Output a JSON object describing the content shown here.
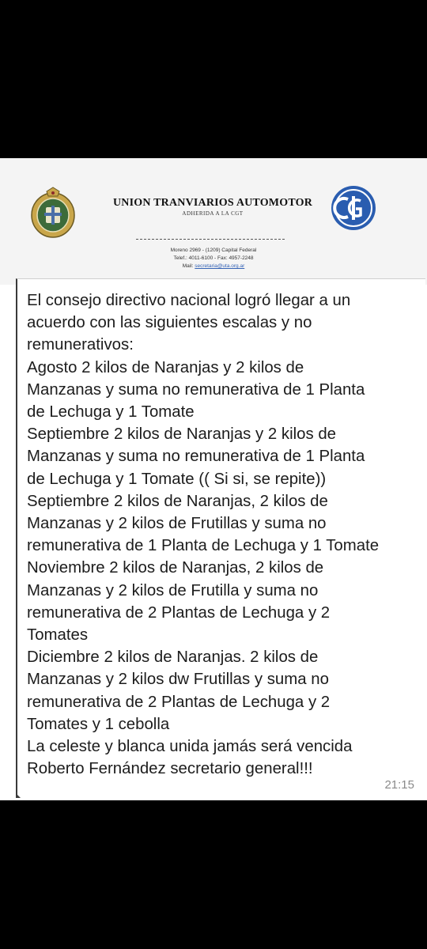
{
  "colors": {
    "background": "#000000",
    "bubble": "#ffffff",
    "letterhead": "#f4f4f4",
    "cgt_blue": "#2a5db0",
    "crest_green": "#3d6b3a",
    "crest_gold": "#c9a64a",
    "timestamp": "#8a8a8a"
  },
  "letterhead": {
    "org_name": "UNION TRANVIARIOS AUTOMOTOR",
    "affiliation": "ADHERIDA A LA CGT",
    "address": "Moreno 2969 - (1209) Capital Federal",
    "phone": "Telef.: 4011-6100 - Fax: 4957-2248",
    "mail_label": "Mail:",
    "mail": "secretaria@uta.org.ar",
    "crest_icon": "union-crest-logo",
    "cgt_icon": "cgt-logo"
  },
  "message": {
    "lines": [
      "El consejo directivo nacional logró llegar  a un",
      "acuerdo con las siguientes escalas y no",
      "remunerativos:",
      " Agosto 2 kilos de Naranjas y 2 kilos de",
      "Manzanas y suma no remunerativa de 1 Planta",
      "de Lechuga y 1 Tomate",
      " Septiembre 2 kilos de Naranjas y 2 kilos de",
      "Manzanas y suma no remunerativa de 1 Planta",
      "de Lechuga y 1 Tomate (( Si si, se repite))",
      "Septiembre 2 kilos de Naranjas, 2 kilos de",
      "Manzanas y 2 kilos de Frutillas y suma no",
      "remunerativa de 1 Planta de Lechuga y 1 Tomate",
      " Noviembre 2 kilos de Naranjas, 2 kilos de",
      "Manzanas y 2 kilos de Frutilla y suma no",
      "remunerativa de 2 Plantas de Lechuga y 2",
      "Tomates",
      " Diciembre 2 kilos de Naranjas. 2 kilos de",
      "Manzanas y 2 kilos dw Frutillas y suma no",
      "remunerativa de 2 Plantas de Lechuga y 2",
      "Tomates y 1 cebolla",
      "   La celeste y blanca unida jamás será vencida",
      "Roberto Fernández secretario general!!!"
    ],
    "time": "21:15"
  }
}
